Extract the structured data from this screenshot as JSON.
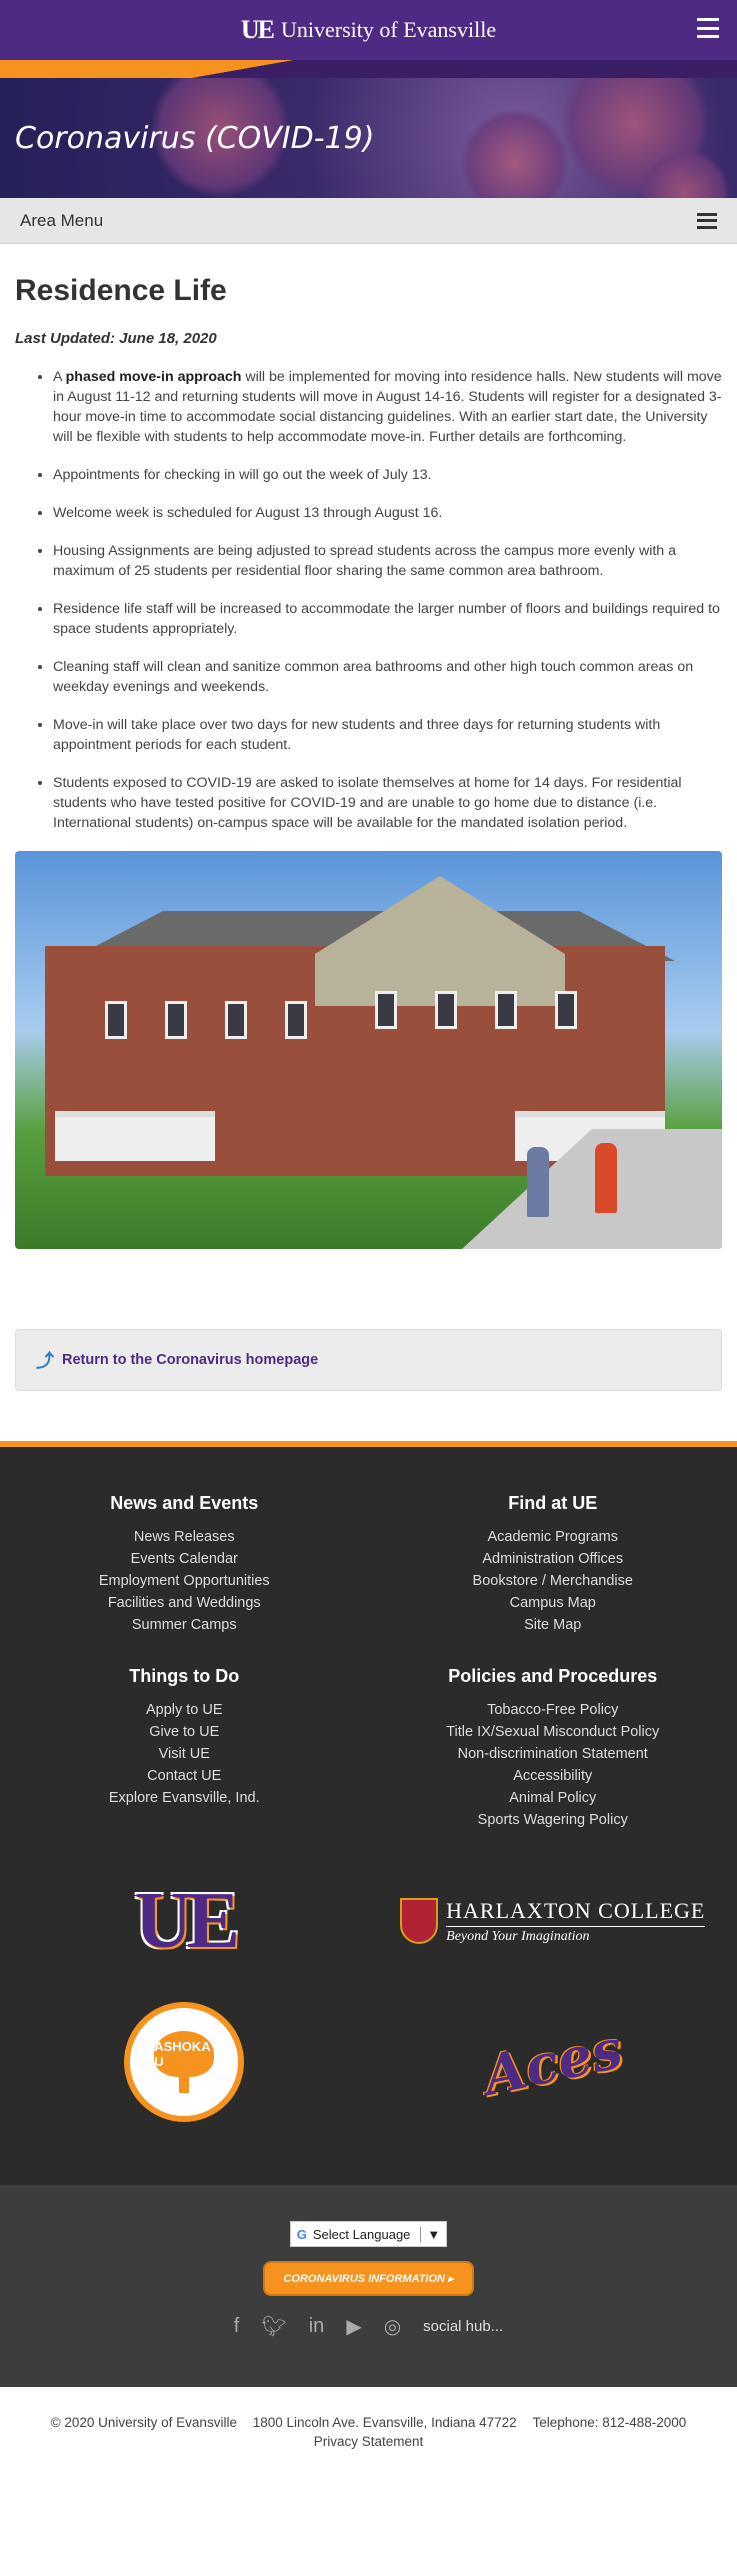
{
  "header": {
    "logo_text": "UE",
    "brand_name": "University of Evansville"
  },
  "hero": {
    "title": "Coronavirus (COVID-19)"
  },
  "area_menu": {
    "label": "Area Menu"
  },
  "main": {
    "title": "Residence Life",
    "last_updated": "Last Updated: June 18, 2020",
    "bullets": [
      {
        "prefix": "A ",
        "bold": "phased move-in approach",
        "text": " will be implemented for moving into residence halls. New students will move in August 11-12 and returning students will move in August 14-16. Students will register for a designated 3-hour move-in time to accommodate social distancing guidelines. With an earlier start date, the University will be flexible with students to help accommodate move-in. Further details are forthcoming."
      },
      {
        "text": "Appointments for checking in will go out the week of July 13."
      },
      {
        "text": "Welcome week is scheduled for August 13 through August 16."
      },
      {
        "text": "Housing Assignments are being adjusted to spread students across the campus more evenly with a maximum of 25 students per residential floor sharing the same common area bathroom."
      },
      {
        "text": "Residence life staff will be increased to accommodate the larger number of floors and buildings required to space students appropriately."
      },
      {
        "text": "Cleaning staff will clean and sanitize common area bathrooms and other high touch common areas on weekday evenings and weekends."
      },
      {
        "text": "Move-in will take place over two days for new students and three days for returning students with appointment periods for each student."
      },
      {
        "text": "Students exposed to COVID-19 are asked to isolate themselves at home for 14 days. For residential students who have tested positive for COVID-19 and are unable to go home due to distance (i.e. International students) on-campus space will be available for the mandated isolation period."
      }
    ],
    "return_link": "Return to the Coronavirus homepage"
  },
  "footer": {
    "columns": [
      {
        "title": "News and Events",
        "links": [
          "News Releases",
          "Events Calendar",
          "Employment Opportunities",
          "Facilities and Weddings",
          "Summer Camps"
        ]
      },
      {
        "title": "Find at UE",
        "links": [
          "Academic Programs",
          "Administration Offices",
          "Bookstore / Merchandise",
          "Campus Map",
          "Site Map"
        ]
      },
      {
        "title": "Things to Do",
        "links": [
          "Apply to UE",
          "Give to UE",
          "Visit UE",
          "Contact UE",
          "Explore Evansville, Ind."
        ]
      },
      {
        "title": "Policies and Procedures",
        "links": [
          "Tobacco-Free Policy",
          "Title IX/Sexual Misconduct Policy",
          "Non-discrimination Statement",
          "Accessibility",
          "Animal Policy",
          "Sports Wagering Policy"
        ]
      }
    ],
    "logos": {
      "ue": "UE",
      "harlaxton_name": "HARLAXTON",
      "harlaxton_college": "COLLEGE",
      "harlaxton_tagline": "Beyond Your Imagination",
      "ashoka": "ASHOKA U",
      "aces": "Aces"
    },
    "language": "Select Language",
    "covid_button": "CORONAVIRUS INFORMATION ▸",
    "social_hub": "social hub...",
    "copyright": "© 2020 University of Evansville",
    "address": "1800 Lincoln Ave. Evansville, Indiana 47722",
    "telephone": "Telephone: 812-488-2000",
    "privacy": "Privacy Statement"
  }
}
